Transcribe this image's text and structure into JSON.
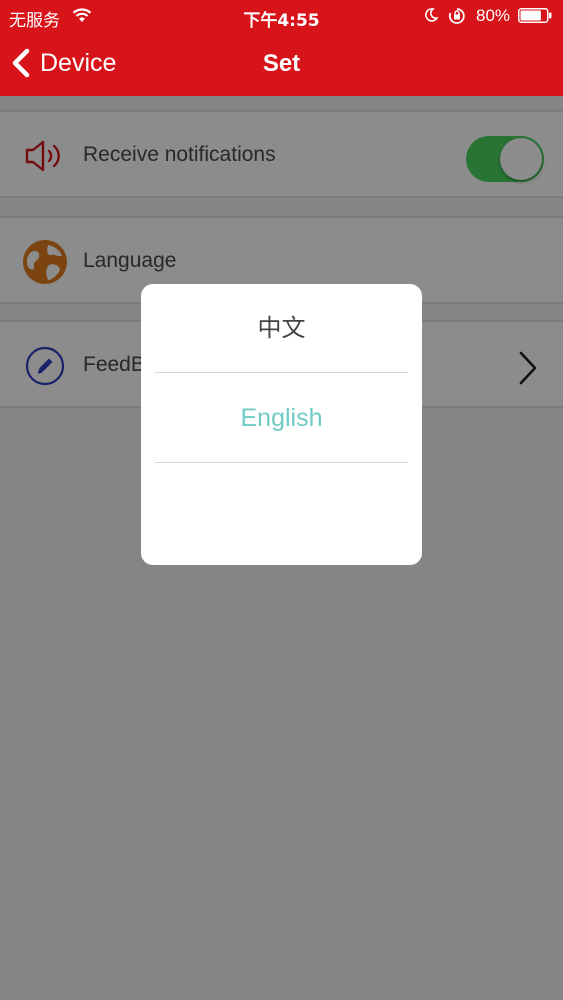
{
  "status_bar": {
    "carrier": "无服务",
    "time": "下午4:55",
    "battery_percent": "80%",
    "icons": [
      "wifi-icon",
      "moon-icon",
      "orientation-lock-icon",
      "battery-icon"
    ],
    "battery_level": 0.8
  },
  "nav": {
    "back_label": "Device",
    "title": "Set"
  },
  "settings": {
    "notifications": {
      "label": "Receive notifications",
      "enabled": true,
      "icon": "speaker-icon"
    },
    "language": {
      "label": "Language",
      "icon": "globe-icon"
    },
    "feedback": {
      "label": "FeedB",
      "icon": "pencil-icon"
    }
  },
  "language_dialog": {
    "options": [
      "中文",
      "English"
    ],
    "selected": "English"
  },
  "colors": {
    "header": "#d8141b",
    "toggle_on": "#4bd45f",
    "selected_option": "#6fcbc4",
    "speaker_icon": "#d8141b",
    "globe_icon": "#e07c1e",
    "pencil_icon": "#2f3fc0"
  }
}
